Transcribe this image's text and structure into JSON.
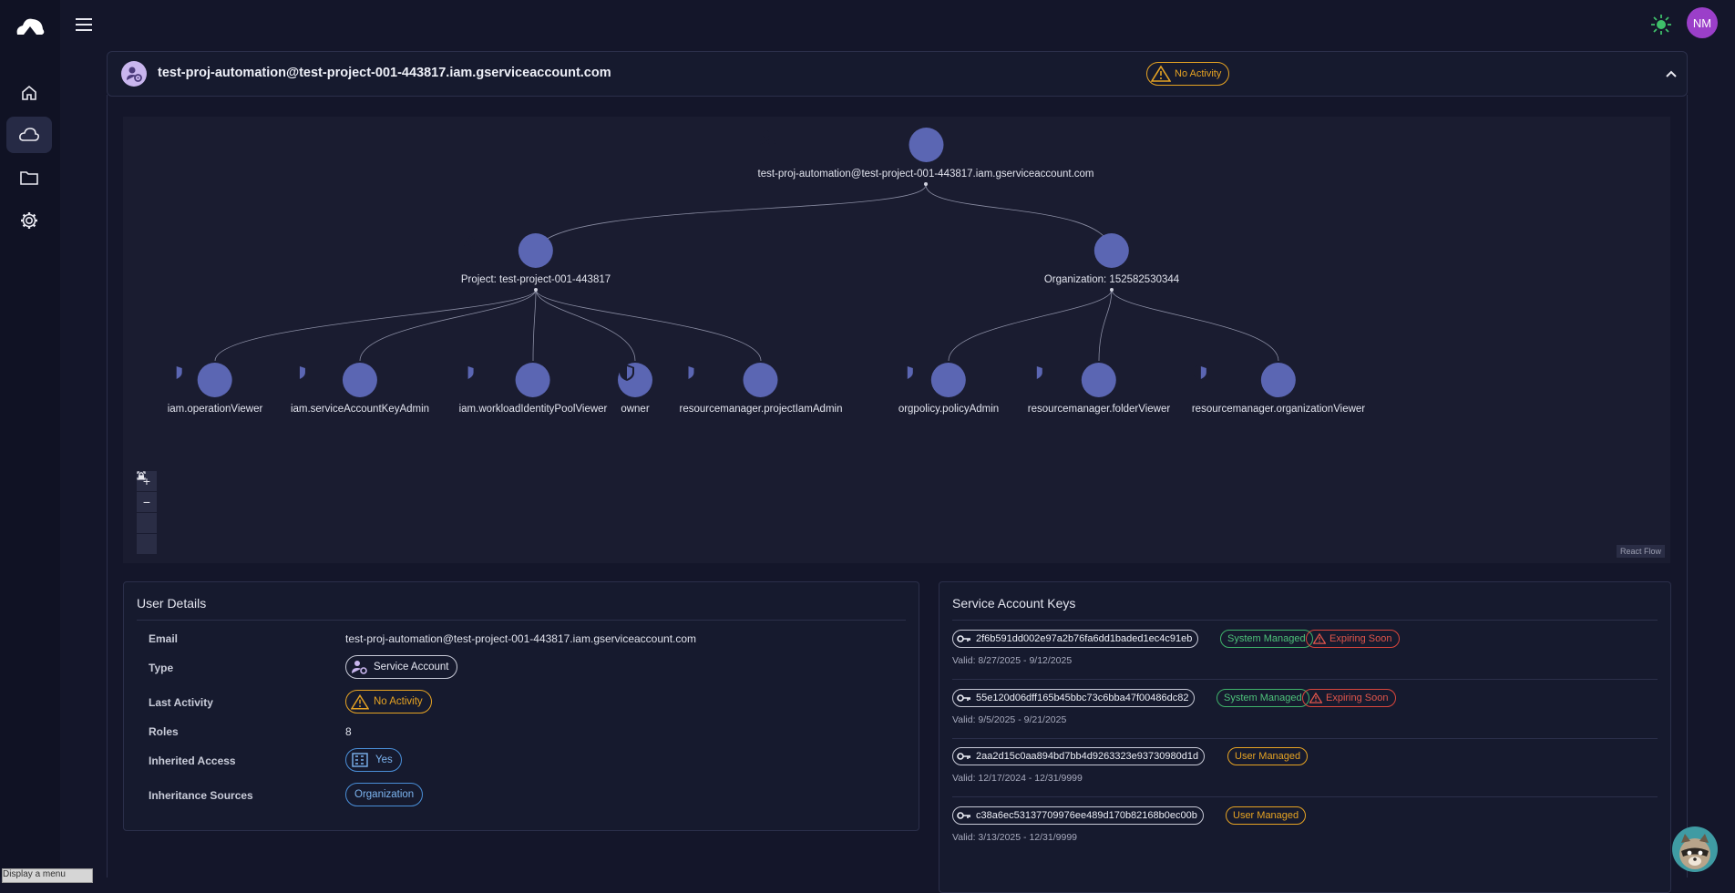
{
  "app": {
    "user_initials": "NM"
  },
  "header": {
    "title": "test-proj-automation@test-project-001-443817.iam.gserviceaccount.com",
    "activity_badge": "No Activity"
  },
  "graph": {
    "root": "test-proj-automation@test-project-001-443817.iam.gserviceaccount.com",
    "project": "Project: test-project-001-443817",
    "organization": "Organization: 152582530344",
    "project_roles": [
      "iam.operationViewer",
      "iam.serviceAccountKeyAdmin",
      "iam.workloadIdentityPoolViewer",
      "owner",
      "resourcemanager.projectIamAdmin"
    ],
    "org_roles": [
      "orgpolicy.policyAdmin",
      "resourcemanager.folderViewer",
      "resourcemanager.organizationViewer"
    ],
    "zoom_in": "+",
    "zoom_out": "−",
    "attribution": "React Flow"
  },
  "user_details": {
    "title": "User Details",
    "rows": [
      {
        "label": "Email",
        "value": "test-proj-automation@test-project-001-443817.iam.gserviceaccount.com"
      },
      {
        "label": "Type",
        "value": "Service Account"
      },
      {
        "label": "Last Activity",
        "value": "No Activity"
      },
      {
        "label": "Roles",
        "value": "8"
      },
      {
        "label": "Inherited Access",
        "value": "Yes"
      },
      {
        "label": "Inheritance Sources",
        "value": "Organization"
      }
    ]
  },
  "keys": {
    "title": "Service Account Keys",
    "items": [
      {
        "id": "2f6b591dd002e97a2b76fa6dd1baded1ec4c91eb",
        "managed": "System Managed",
        "status": "Expiring Soon",
        "valid": "Valid: 8/27/2025 - 9/12/2025"
      },
      {
        "id": "55e120d06dff165b45bbc73c6bba47f00486dc82",
        "managed": "System Managed",
        "status": "Expiring Soon",
        "valid": "Valid: 9/5/2025 - 9/21/2025"
      },
      {
        "id": "2aa2d15c0aa894bd7bb4d9263323e93730980d1d",
        "managed": "User Managed",
        "status": "",
        "valid": "Valid: 12/17/2024 - 12/31/9999"
      },
      {
        "id": "c38a6ec53137709976ee489d170b82168b0ec00b",
        "managed": "User Managed",
        "status": "",
        "valid": "Valid: 3/13/2025 - 12/31/9999"
      }
    ]
  },
  "tooltip": "Display a menu",
  "colors": {
    "accent": "#5b66b3",
    "warning": "#e6a323",
    "success": "#4ec27a",
    "danger": "#e0554b",
    "avatar": "#9b3fc9"
  }
}
